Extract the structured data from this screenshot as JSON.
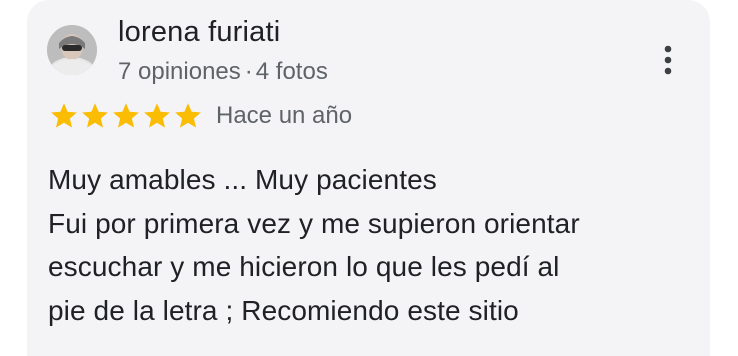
{
  "review": {
    "reviewer_name": "lorena furiati",
    "reviews_count": "7 opiniones",
    "separator": "·",
    "photos_count": "4 fotos",
    "rating": 5,
    "rating_max": 5,
    "date": "Hace un año",
    "text_lines": [
      "Muy amables ... Muy pacientes",
      "Fui por primera vez y me supieron orientar",
      "escuchar y me hicieron lo que les pedí al",
      "pie de la letra ; Recomiendo este sitio"
    ]
  },
  "icons": {
    "more": "more-vert-icon",
    "star": "star-icon",
    "avatar": "user-avatar"
  },
  "colors": {
    "star": "#fbbc04",
    "card_background": "#f4f4f6",
    "secondary_text": "#5f6368",
    "primary_text": "#202124"
  }
}
